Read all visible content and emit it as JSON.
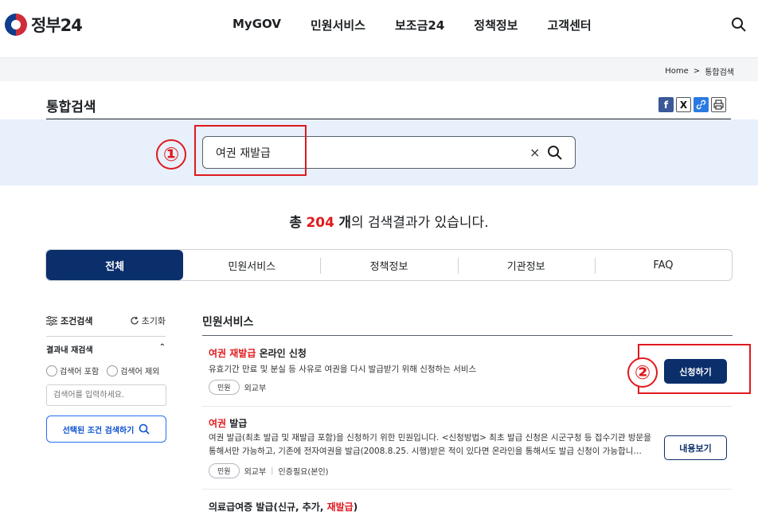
{
  "header": {
    "logo_text": "정부24",
    "nav": [
      "MyGOV",
      "민원서비스",
      "보조금24",
      "정책정보",
      "고객센터"
    ]
  },
  "breadcrumb": [
    "Home",
    "통합검색"
  ],
  "page": {
    "title": "통합검색",
    "share_icons": [
      "facebook-icon",
      "x-icon",
      "link-icon",
      "print-icon"
    ]
  },
  "search": {
    "value": "여권 재발급",
    "clear_glyph": "×"
  },
  "annotations": {
    "marker1": "①",
    "marker2": "②"
  },
  "results_summary": {
    "prefix": "총",
    "count": "204",
    "unit": "개",
    "suffix": "의 검색결과가 있습니다."
  },
  "tabs": [
    {
      "label": "전체",
      "active": true
    },
    {
      "label": "민원서비스",
      "active": false
    },
    {
      "label": "정책정보",
      "active": false
    },
    {
      "label": "기관정보",
      "active": false
    },
    {
      "label": "FAQ",
      "active": false
    }
  ],
  "sidebar": {
    "filter_label": "조건검색",
    "reset_label": "초기화",
    "refine_label": "결과내 재검색",
    "include_label": "검색어 포함",
    "exclude_label": "검색어 제외",
    "input_placeholder": "검색어를 입력하세요.",
    "search_button": "선택된 조건 검색하기"
  },
  "section": {
    "title": "민원서비스"
  },
  "results": [
    {
      "title_highlight": "여권 재발급",
      "title_rest": " 온라인 신청",
      "desc": "유효기간 만료 및 분실 등 사유로 여권을 다시 발급받기 위해 신청하는 서비스",
      "badge": "민원",
      "agency": "외교부",
      "extra": "",
      "button": "신청하기"
    },
    {
      "title_highlight": "여권",
      "title_rest": " 발급",
      "desc": "여권 발급(최초 발급 및 재발급 포함)을 신청하기 위한 민원입니다. <신청방법> 최초 발급 신청은 시군구청 등 접수기관 방문을 통해서만 가능하고, 기존에 전자여권을 발급(2008.8.25. 시행)받은 적이 있다면 온라인을 통해서도 발급 신청이 가능합니…",
      "badge": "민원",
      "agency": "외교부",
      "extra": "인증필요(본인)",
      "button": "내용보기"
    },
    {
      "title_prefix": "의료급여증 발급(신규, 추가, ",
      "title_highlight": "재발급",
      "title_suffix": ")"
    }
  ]
}
